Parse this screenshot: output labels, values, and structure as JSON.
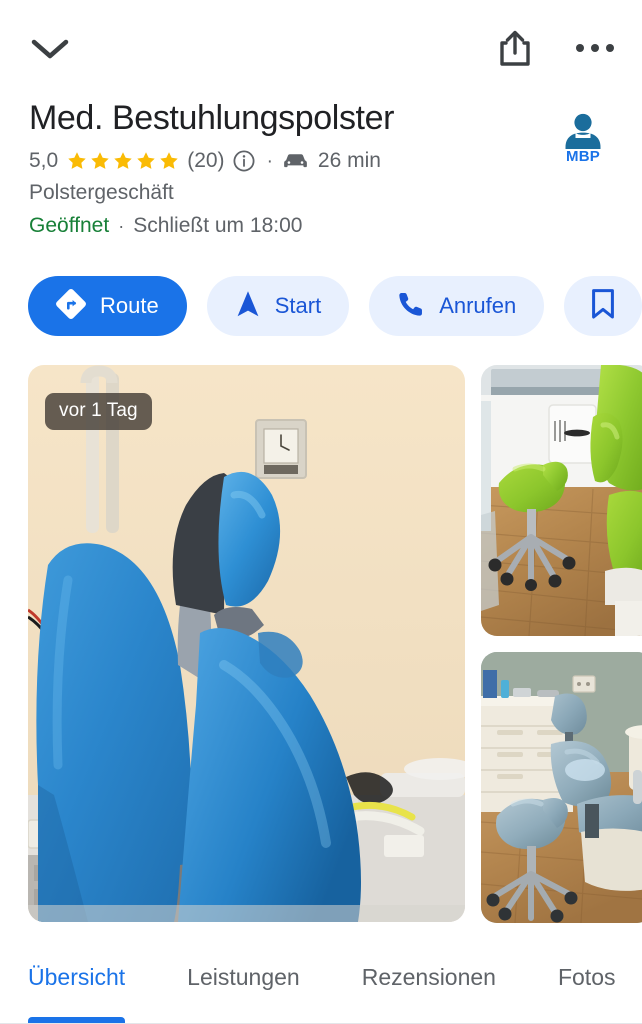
{
  "header": {
    "collapse_icon": "chevron-down-icon",
    "share_icon": "share-icon",
    "more_icon": "more-options-icon"
  },
  "place": {
    "name": "Med. Bestuhlungspolster",
    "rating": "5,0",
    "stars": 5,
    "review_count": "(20)",
    "info_icon": "info-icon",
    "separator": "·",
    "travel_icon": "car-icon",
    "travel_time": "26 min",
    "category": "Polstergeschäft",
    "open_state": "Geöffnet",
    "hours_separator": "·",
    "closing_text": "Schließt um 18:00",
    "logo_initials": "MBP",
    "logo_icon": "person-avatar-icon"
  },
  "actions": [
    {
      "label": "Route",
      "icon": "directions-icon",
      "style": "primary"
    },
    {
      "label": "Start",
      "icon": "navigation-arrow-icon",
      "style": "ghost"
    },
    {
      "label": "Anrufen",
      "icon": "phone-icon",
      "style": "ghost"
    },
    {
      "label": "",
      "icon": "bookmark-icon",
      "style": "ghost"
    }
  ],
  "photos": {
    "badge": "vor 1 Tag",
    "main_alt": "Blaue Behandlungsstühle mit Kopfstütze",
    "small_1_alt": "Grüner Sattelhocker und grüner Behandlungsstuhl",
    "small_2_alt": "Grau-blauer Behandlungsstuhl mit Sattelhocker"
  },
  "tabs": [
    {
      "label": "Übersicht",
      "active": true
    },
    {
      "label": "Leistungen",
      "active": false
    },
    {
      "label": "Rezensionen",
      "active": false
    },
    {
      "label": "Fotos",
      "active": false
    }
  ],
  "colors": {
    "primary_blue": "#1a73e8",
    "light_blue": "#e8f0fe",
    "open_green": "#188038",
    "star_gold": "#fabb05",
    "text_primary": "#202124",
    "text_secondary": "#5f6368"
  }
}
